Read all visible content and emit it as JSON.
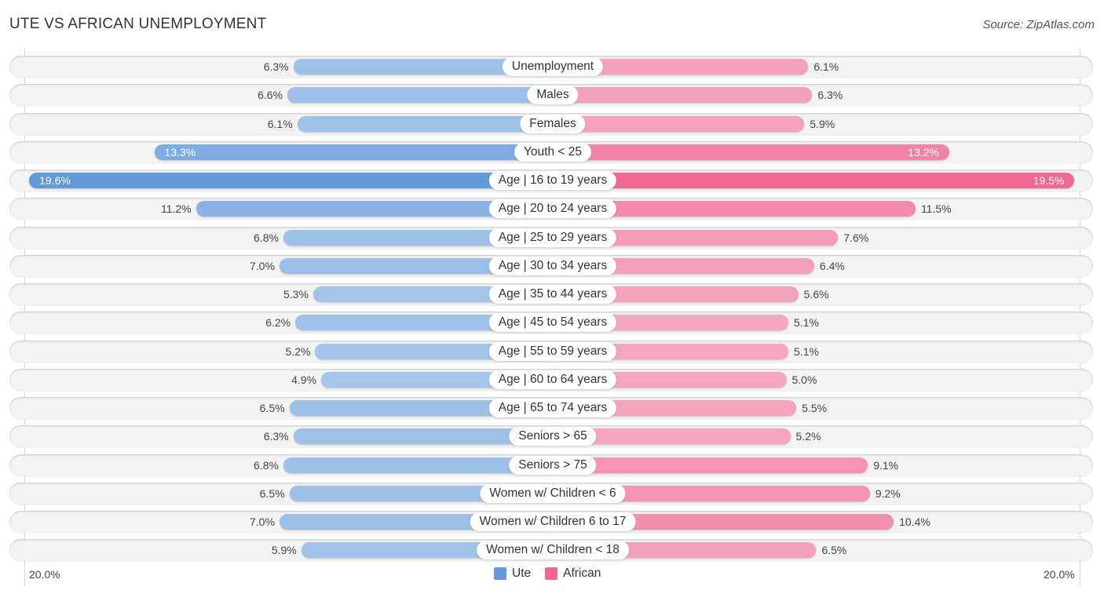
{
  "header": {
    "title": "UTE VS AFRICAN UNEMPLOYMENT",
    "source": "Source: ZipAtlas.com"
  },
  "colors": {
    "ute_light": "#a5c5ea",
    "ute_strong": "#6399d8",
    "african_light": "#f5a6bf",
    "african_strong": "#f06792"
  },
  "chart_data": {
    "type": "bar",
    "orientation": "horizontal-diverging",
    "title": "UTE VS AFRICAN UNEMPLOYMENT",
    "xlabel": "",
    "ylabel": "",
    "xlim": [
      0,
      20.0
    ],
    "axis_labels": {
      "left": "20.0%",
      "right": "20.0%"
    },
    "legend": {
      "position": "bottom-center",
      "entries": [
        "Ute",
        "African"
      ]
    },
    "categories": [
      "Unemployment",
      "Males",
      "Females",
      "Youth < 25",
      "Age | 16 to 19 years",
      "Age | 20 to 24 years",
      "Age | 25 to 29 years",
      "Age | 30 to 34 years",
      "Age | 35 to 44 years",
      "Age | 45 to 54 years",
      "Age | 55 to 59 years",
      "Age | 60 to 64 years",
      "Age | 65 to 74 years",
      "Seniors > 65",
      "Seniors > 75",
      "Women w/ Children < 6",
      "Women w/ Children 6 to 17",
      "Women w/ Children < 18"
    ],
    "series": [
      {
        "name": "Ute",
        "side": "left",
        "values": [
          6.3,
          6.6,
          6.1,
          13.3,
          19.6,
          11.2,
          6.8,
          7.0,
          5.3,
          6.2,
          5.2,
          4.9,
          6.5,
          6.3,
          6.8,
          6.5,
          7.0,
          5.9
        ],
        "labels": [
          "6.3%",
          "6.6%",
          "6.1%",
          "13.3%",
          "19.6%",
          "11.2%",
          "6.8%",
          "7.0%",
          "5.3%",
          "6.2%",
          "5.2%",
          "4.9%",
          "6.5%",
          "6.3%",
          "6.8%",
          "6.5%",
          "7.0%",
          "5.9%"
        ]
      },
      {
        "name": "African",
        "side": "right",
        "values": [
          6.1,
          6.3,
          5.9,
          13.2,
          19.5,
          11.5,
          7.6,
          6.4,
          5.6,
          5.1,
          5.1,
          5.0,
          5.5,
          5.2,
          9.1,
          9.2,
          10.4,
          6.5
        ],
        "labels": [
          "6.1%",
          "6.3%",
          "5.9%",
          "13.2%",
          "19.5%",
          "11.5%",
          "7.6%",
          "6.4%",
          "5.6%",
          "5.1%",
          "5.1%",
          "5.0%",
          "5.5%",
          "5.2%",
          "9.1%",
          "9.2%",
          "10.4%",
          "6.5%"
        ]
      }
    ]
  }
}
